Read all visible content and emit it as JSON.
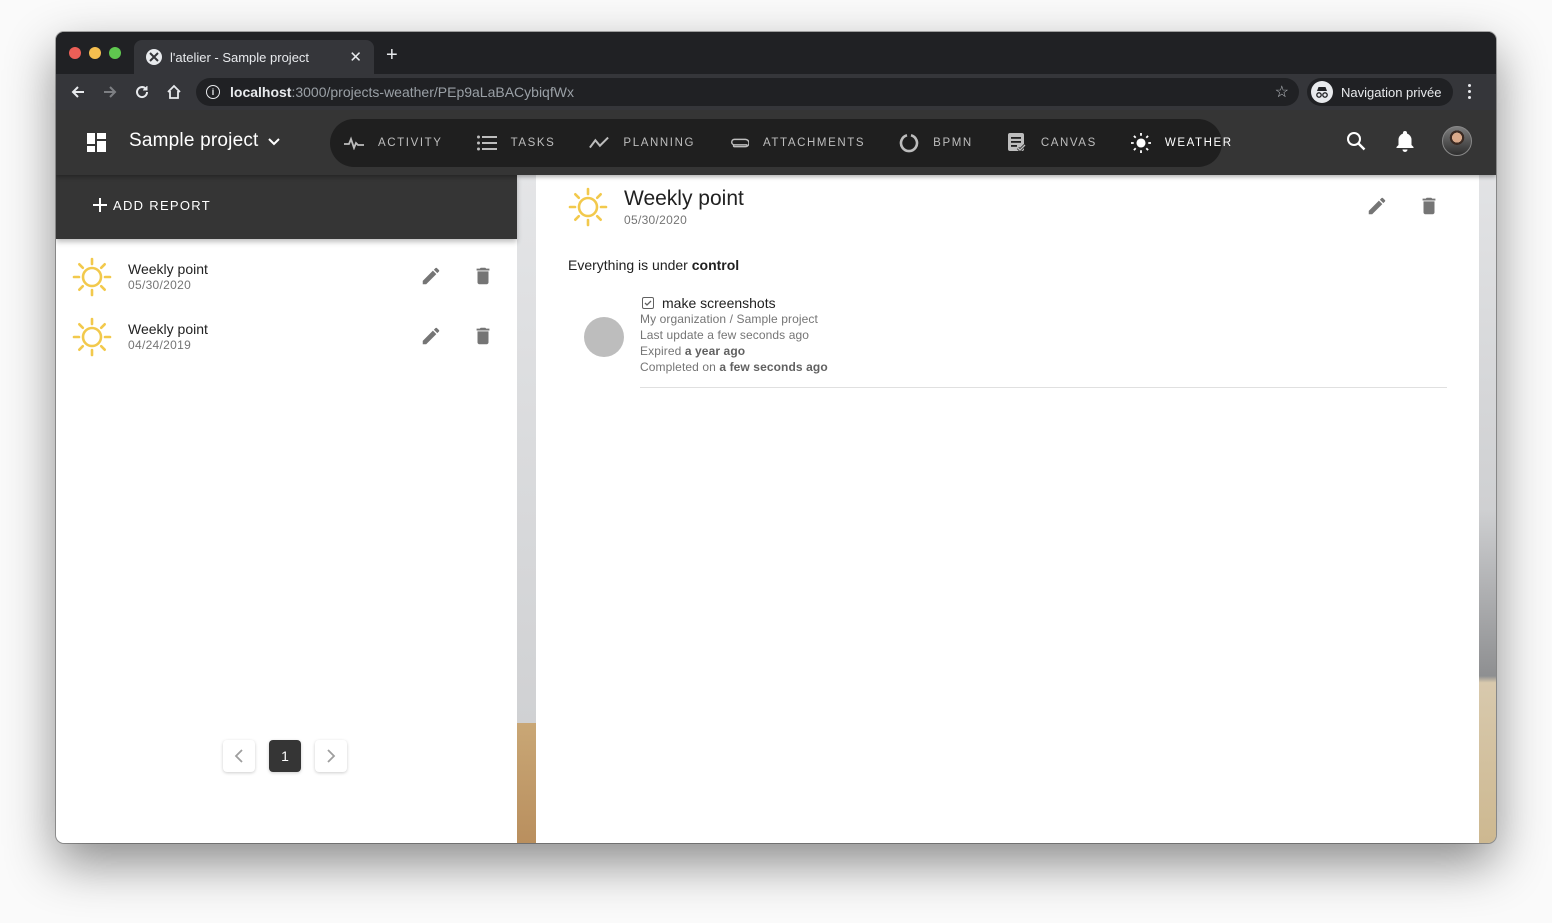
{
  "browser": {
    "tab_title": "l'atelier - Sample project",
    "new_tab_label": "+",
    "url_host": "localhost",
    "url_rest": ":3000/projects-weather/PEp9aLaBACybiqfWx",
    "incognito_label": "Navigation privée"
  },
  "appbar": {
    "project_name": "Sample project",
    "nav": [
      {
        "label": "ACTIVITY",
        "icon": "activity-icon",
        "active": false
      },
      {
        "label": "TASKS",
        "icon": "list-icon",
        "active": false
      },
      {
        "label": "PLANNING",
        "icon": "trending-icon",
        "active": false
      },
      {
        "label": "ATTACHMENTS",
        "icon": "paperclip-icon",
        "active": false
      },
      {
        "label": "BPMN",
        "icon": "circle-notch-icon",
        "active": false
      },
      {
        "label": "CANVAS",
        "icon": "canvas-doc-icon",
        "active": false
      },
      {
        "label": "WEATHER",
        "icon": "sun-icon",
        "active": true
      }
    ]
  },
  "left_panel": {
    "add_report_label": "ADD REPORT",
    "reports": [
      {
        "title": "Weekly point",
        "date": "05/30/2020",
        "weather": "sunny"
      },
      {
        "title": "Weekly point",
        "date": "04/24/2019",
        "weather": "sunny"
      }
    ],
    "pagination": {
      "current_page": "1"
    }
  },
  "detail": {
    "title": "Weekly point",
    "date": "05/30/2020",
    "weather": "sunny",
    "description_prefix": "Everything is under ",
    "description_bold": "control",
    "task": {
      "title": "make screenshots",
      "completed": true,
      "path": "My organization / Sample project",
      "last_update": "Last update a few seconds ago",
      "expired_prefix": "Expired ",
      "expired_value": "a year ago",
      "completed_prefix": "Completed on ",
      "completed_value": "a few seconds ago"
    }
  },
  "colors": {
    "appbar": "#353535",
    "nav_pill": "#1f1f1f",
    "sun": "#f2c94c",
    "icon_grey": "#757575"
  }
}
